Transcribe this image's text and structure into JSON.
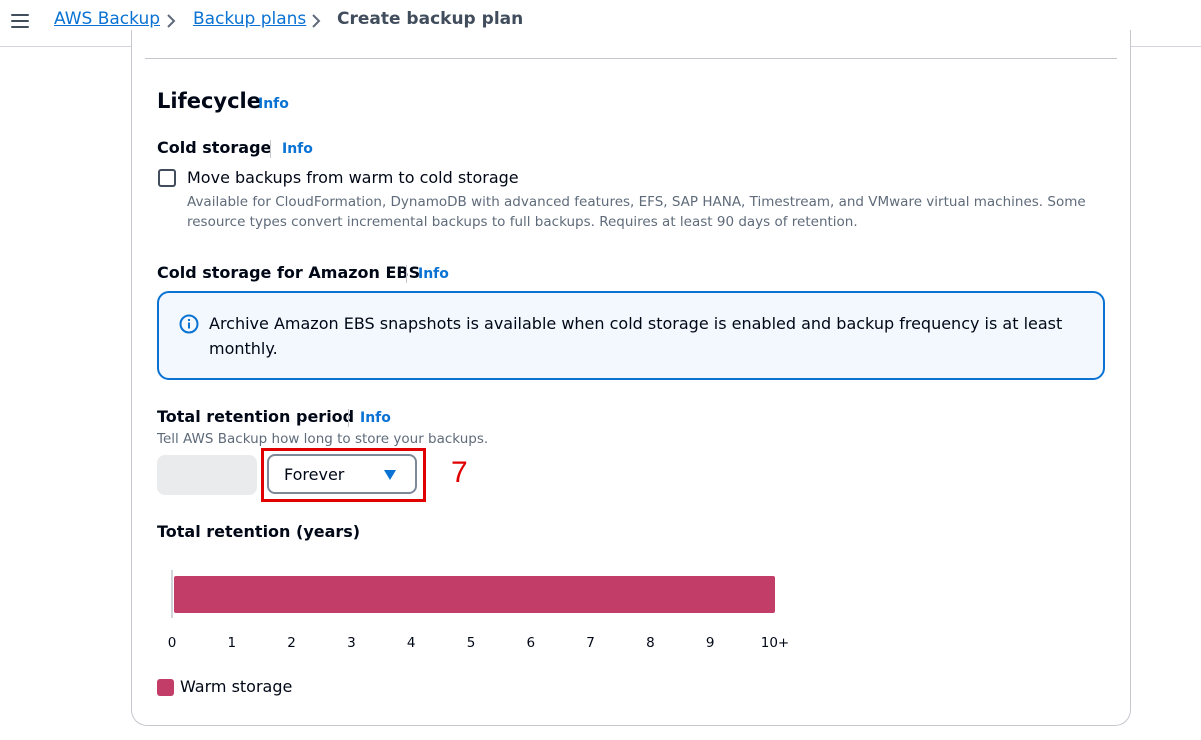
{
  "header": {
    "menu_icon": "hamburger-menu-icon",
    "breadcrumbs": [
      {
        "label": "AWS Backup",
        "link": true
      },
      {
        "label": "Backup plans",
        "link": true
      },
      {
        "label": "Create backup plan",
        "link": false
      }
    ]
  },
  "lifecycle": {
    "title": "Lifecycle",
    "info": "Info"
  },
  "cold_storage": {
    "title": "Cold storage",
    "info": "Info",
    "checkbox_label": "Move backups from warm to cold storage",
    "checkbox_checked": false,
    "description": "Available for CloudFormation, DynamoDB with advanced features, EFS, SAP HANA, Timestream, and VMware virtual machines. Some resource types convert incremental backups to full backups. Requires at least 90 days of retention."
  },
  "cold_storage_ebs": {
    "title": "Cold storage for Amazon EBS",
    "info": "Info",
    "alert_icon": "info-circle-icon",
    "alert_text": "Archive Amazon EBS snapshots is available when cold storage is enabled and backup frequency is at least monthly."
  },
  "retention": {
    "title": "Total retention period",
    "info": "Info",
    "description": "Tell AWS Backup how long to store your backups.",
    "number_value": "",
    "unit_selected": "Forever",
    "annotation": "7"
  },
  "chart_data": {
    "type": "bar",
    "title": "Total retention (years)",
    "orientation": "horizontal",
    "x_ticks": [
      "0",
      "1",
      "2",
      "3",
      "4",
      "5",
      "6",
      "7",
      "8",
      "9",
      "10+"
    ],
    "xlim": [
      0,
      10
    ],
    "series": [
      {
        "name": "Warm storage",
        "values": [
          10
        ],
        "color": "#c33d69"
      }
    ],
    "legend_position": "bottom-left"
  },
  "colors": {
    "link": "#0972d3",
    "warm_storage": "#c33d69",
    "annotation_red": "#e00000",
    "alert_border": "#0972d3",
    "alert_bg": "#f2f8fd"
  }
}
